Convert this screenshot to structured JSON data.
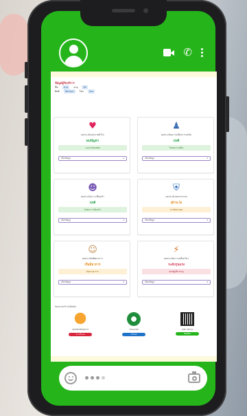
{
  "info": {
    "title": "ข้อมูลผู้รับบริการ",
    "fields": [
      {
        "label": "ชื่อ",
        "value": "ชาย"
      },
      {
        "label": "อายุ",
        "value": "65"
      },
      {
        "label": "สิทธิ",
        "value": "บัตรทอง"
      },
      {
        "label": "โทร",
        "value": "0xx"
      }
    ]
  },
  "cards": [
    {
      "icon": "heart-pulse-icon",
      "glyph": "♥",
      "label": "ผลประเมินสุขภาพทั่วไป",
      "status": "พบปัญหา",
      "note": "แนะนำพบแพทย์",
      "select": "เลือกข้อมูล",
      "tone": "green"
    },
    {
      "icon": "person-icon",
      "glyph": "♟",
      "label": "ผลประเมินความเสี่ยงการหกล้ม",
      "status": "ปกติ",
      "note": "ไม่พบความเสี่ยง",
      "select": "เลือกข้อมูล",
      "tone": "green"
    },
    {
      "icon": "brain-icon",
      "glyph": "☻",
      "label": "ผลประเมินภาวะซึมเศร้า",
      "status": "ปกติ",
      "note": "ไม่พบภาวะซึมเศร้า",
      "select": "เลือกข้อมูล",
      "tone": "green"
    },
    {
      "icon": "shield-icon",
      "glyph": "⛨",
      "label": "ผลประเมินสมรรถภาพ",
      "status": "เฝ้าระวัง",
      "note": "ควรติดตามผล",
      "select": "เลือกข้อมูล",
      "tone": "orange"
    },
    {
      "icon": "child-icon",
      "glyph": "☺",
      "label": "ผลประเมินพัฒนาการ",
      "status": "เริ่มมีอาการ",
      "note": "ติดตามอาการ",
      "select": "เลือกข้อมูล",
      "tone": "orange"
    },
    {
      "icon": "runner-icon",
      "glyph": "⚡",
      "label": "ผลประเมินการเคลื่อนไหว",
      "status": "ระดับรุนแรง",
      "note": "ส่งต่อผู้เชี่ยวชาญ",
      "select": "เลือกข้อมูล",
      "tone": "pink"
    }
  ],
  "services": {
    "heading": "ช่องทางบริการเพิ่มเติม",
    "items": [
      {
        "icon": "tiger-mascot-icon",
        "caption": "แอปพลิเคชันสุขภาพ",
        "pill": "ดาวน์โหลด",
        "color": "#d7263d"
      },
      {
        "icon": "health-dept-logo-icon",
        "caption": "กรมอนามัย",
        "pill": "เว็บไซต์",
        "color": "#1f73c9"
      },
      {
        "icon": "qr-code-icon",
        "caption": "LINE Official",
        "pill": "เพิ่มเพื่อน",
        "color": "#25b51b"
      }
    ]
  },
  "colors": {
    "screen": "#25b51b",
    "accent": "#9a86c8"
  }
}
